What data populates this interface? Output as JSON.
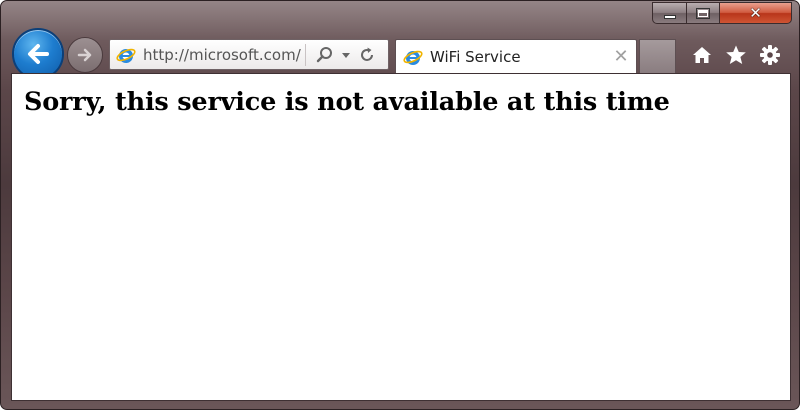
{
  "window": {
    "controls": {
      "minimize_icon": "minimize-icon",
      "maximize_icon": "maximize-icon",
      "close_icon": "close-icon",
      "close_glyph": "✕"
    }
  },
  "navigation": {
    "back_icon": "back-arrow-icon",
    "forward_icon": "forward-arrow-icon"
  },
  "address_bar": {
    "url": "http://microsoft.com/",
    "favicon": "ie-icon",
    "tools": [
      "search-icon",
      "dropdown-icon",
      "refresh-icon"
    ]
  },
  "tabs": [
    {
      "title": "WiFi Service",
      "favicon": "ie-icon",
      "close_glyph": "✕",
      "active": true
    }
  ],
  "toolbar": {
    "items": [
      "home-icon",
      "favorites-star-icon",
      "tools-gear-icon"
    ]
  },
  "page": {
    "heading": "Sorry, this service is not available at this time"
  },
  "colors": {
    "frame": "#5b4649",
    "back_button": "#1e7dcf",
    "close_button": "#c94a2c",
    "ie_logo": "#2a8be0",
    "ie_ring": "#f0b400"
  }
}
